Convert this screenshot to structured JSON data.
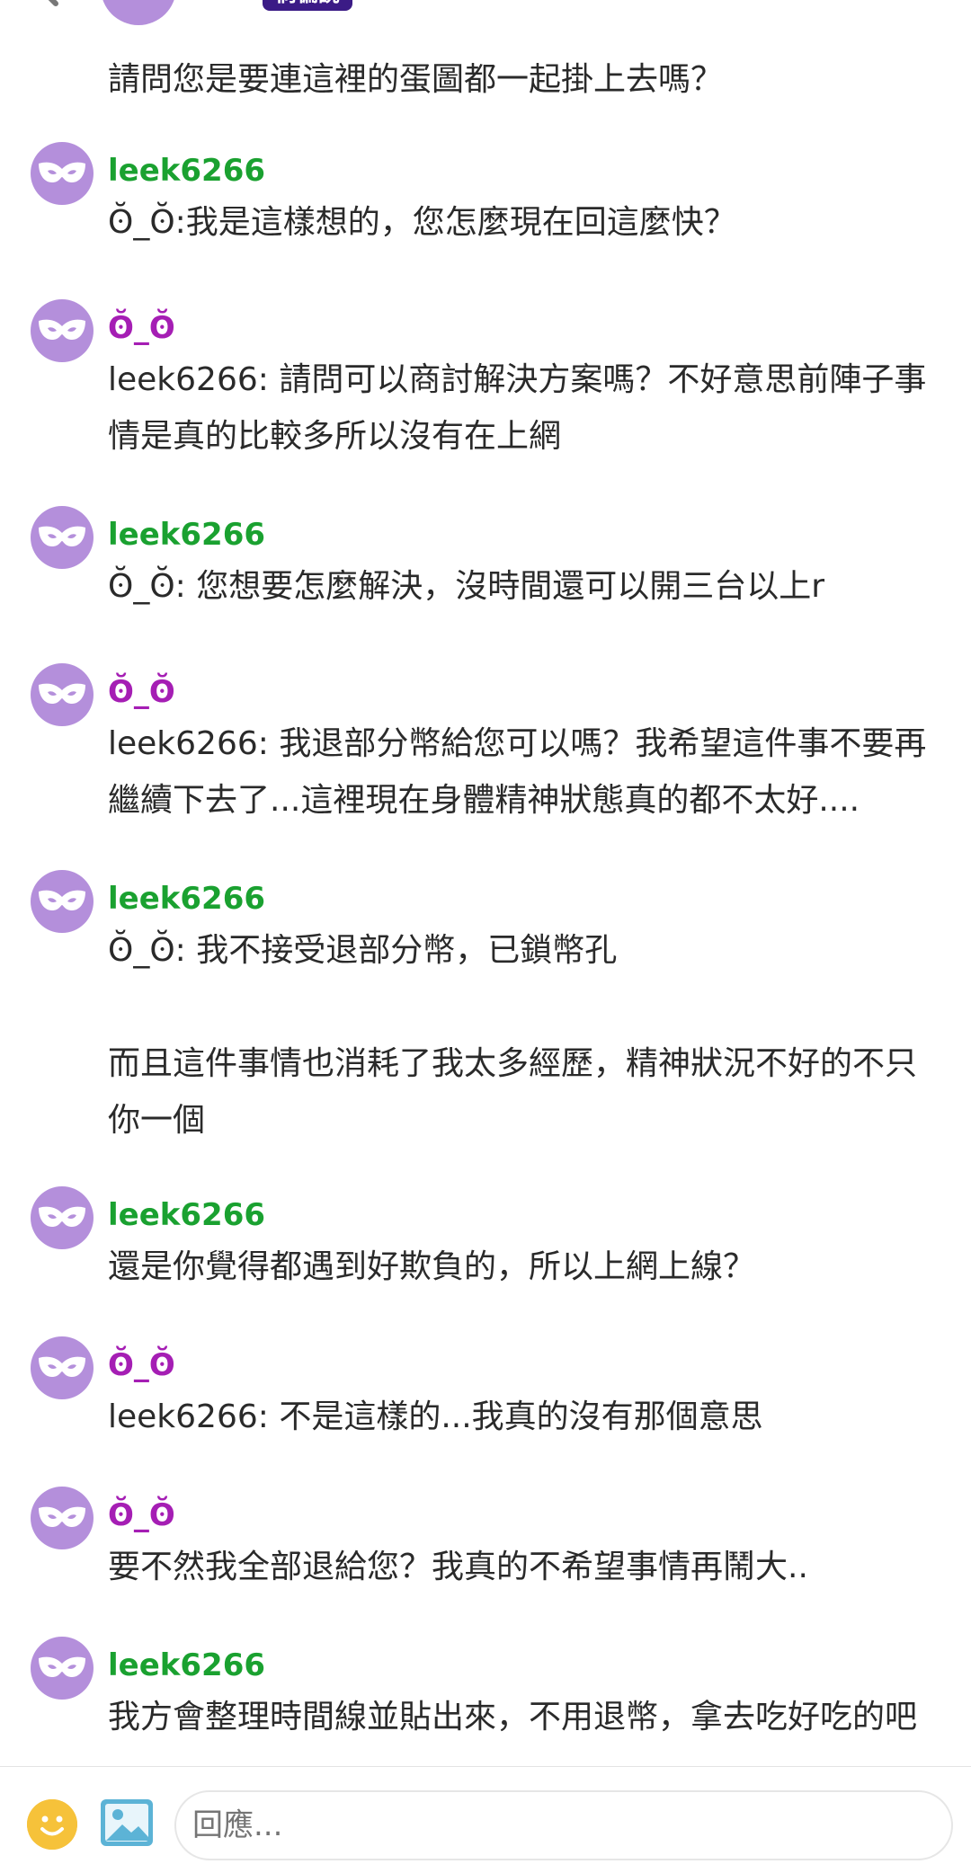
{
  "header": {
    "badge_label": "倘偏說"
  },
  "first_message": "請問您是要連這裡的蛋圖都一起掛上去嗎？",
  "messages": [
    {
      "name": "leek6266",
      "color": "green",
      "text": "ʘ̆_ʘ̆:我是這樣想的，您怎麼現在回這麼快？"
    },
    {
      "name": "ʘ̆_ʘ̆",
      "color": "purple",
      "text": "leek6266: 請問可以商討解決方案嗎？不好意思前陣子事情是真的比較多所以沒有在上網"
    },
    {
      "name": "leek6266",
      "color": "green",
      "text": "ʘ̆_ʘ̆: 您想要怎麼解決，沒時間還可以開三台以上r"
    },
    {
      "name": "ʘ̆_ʘ̆",
      "color": "purple",
      "text": "leek6266: 我退部分幣給您可以嗎？我希望這件事不要再繼續下去了...這裡現在身體精神狀態真的都不太好...."
    },
    {
      "name": "leek6266",
      "color": "green",
      "text": "ʘ̆_ʘ̆: 我不接受退部分幣，已鎖幣孔\n\n而且這件事情也消耗了我太多經歷，精神狀況不好的不只你一個"
    },
    {
      "name": "leek6266",
      "color": "green",
      "text": "還是你覺得都遇到好欺負的，所以上網上線？"
    },
    {
      "name": "ʘ̆_ʘ̆",
      "color": "purple",
      "text": "leek6266: 不是這樣的...我真的沒有那個意思"
    },
    {
      "name": "ʘ̆_ʘ̆",
      "color": "purple",
      "text": "要不然我全部退給您？我真的不希望事情再鬧大.."
    },
    {
      "name": "leek6266",
      "color": "green",
      "text": "我方會整理時間線並貼出來，不用退幣，拿去吃好吃的吧"
    }
  ],
  "composer": {
    "placeholder": "回應...",
    "emoji_icon": "smiley-icon",
    "image_icon": "image-icon"
  },
  "colors": {
    "avatar_bg": "#b48fdb",
    "name_green": "#1aa130",
    "name_purple": "#a51eb4",
    "badge_bg": "#3b1b86"
  }
}
